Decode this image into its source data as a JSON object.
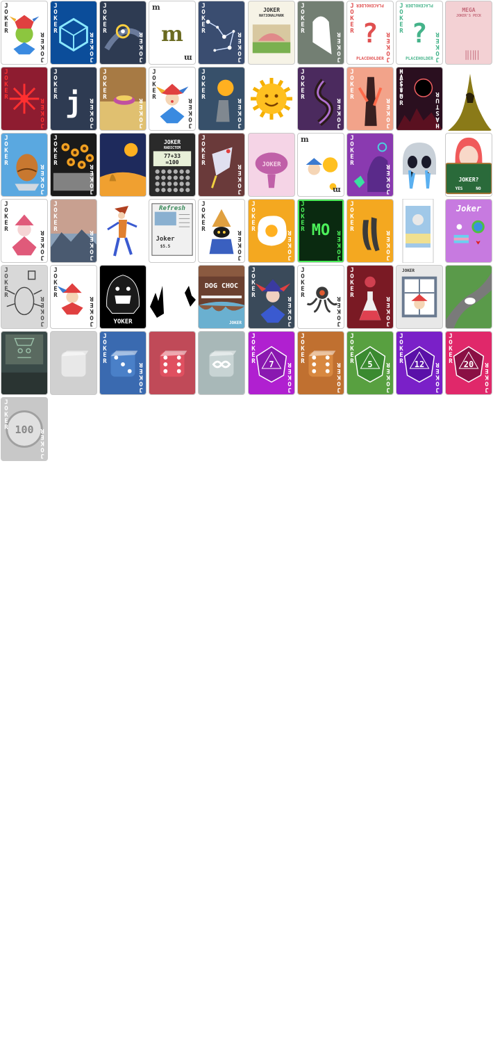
{
  "sheet": {
    "cards": [
      {
        "art": "jester-ball",
        "label": "JOKER",
        "bg": "#ffffff",
        "ink": "#333333"
      },
      {
        "art": "cube",
        "label": "JOKER",
        "bg": "#0b4d9a",
        "ink": "#ffffff"
      },
      {
        "art": "space-star",
        "label": "JOKER",
        "bg": "#2e3b52",
        "ink": "#ffffff"
      },
      {
        "art": "m-letter",
        "corner": "m",
        "bg": "#ffffff",
        "ink": "#333333"
      },
      {
        "art": "constellation",
        "label": "JOKER",
        "bg": "#3a4d70",
        "ink": "#ffffff"
      },
      {
        "art": "national-park",
        "title": "JOKER",
        "subtitle": "NATIONALPARK",
        "bg": "#f6f3e6",
        "ink": "#333333"
      },
      {
        "art": "ghost-glitch",
        "label": "JOKER",
        "bg": "#6c3e9c",
        "ink": "#ffffff"
      },
      {
        "art": "placeholder",
        "label": "JOKER",
        "caption": "PLACEHOLDER",
        "glyph": "?",
        "bg": "#ffffff",
        "ink": "#e05050"
      },
      {
        "art": "placeholder",
        "label": "JOKER",
        "caption": "PLACEHOLDER",
        "glyph": "?",
        "bg": "#ffffff",
        "ink": "#45b38a"
      },
      {
        "art": "receipt",
        "title": "MEGA",
        "subtitle": "JOKER'S PECK",
        "bg": "#f3d1d4",
        "ink": "#c46a7a"
      },
      {
        "art": "red-star",
        "label": "JOKER",
        "bg": "#8e1c30",
        "ink": "#ff3030"
      },
      {
        "art": "j-letter",
        "label": "JOKER",
        "bg": "#2e3b52",
        "ink": "#ffffff"
      },
      {
        "art": "pie-table",
        "label": "JOKER",
        "bg": "#a77a44",
        "ink": "#ffffff"
      },
      {
        "art": "jester",
        "label": "JOKER",
        "bg": "#ffffff",
        "ink": "#333333"
      },
      {
        "art": "sun-hand",
        "label": "JOKER",
        "bg": "#37506a",
        "ink": "#ffffff"
      },
      {
        "art": "sun",
        "bg": "transparent"
      },
      {
        "art": "worm",
        "label": "JOKER",
        "bg": "#4b2a5e",
        "ink": "#ffffff"
      },
      {
        "art": "flame-figure",
        "label": "JOKER",
        "bg": "#f2a38a",
        "ink": "#ffffff"
      },
      {
        "art": "hastur",
        "label": "HASTUR",
        "bg": "#2a0f1f",
        "ink": "#ffffff"
      },
      {
        "art": "robe",
        "bg": "transparent"
      },
      {
        "art": "egg",
        "label": "JOKER",
        "bg": "#5aa8e0",
        "ink": "#ffffff"
      },
      {
        "art": "sunflowers",
        "label": "JOKER",
        "bg": "#1a1a1a",
        "ink": "#ffffff"
      },
      {
        "art": "sun-landscape",
        "bg": "#1e2a5c",
        "ink": "#ffffff"
      },
      {
        "art": "calculator",
        "title": "JOKER",
        "subtitle": "RADICTEM",
        "display_top": "77+33",
        "display_bot": "=100",
        "bg": "#2a2a2a",
        "ink": "#ffffff"
      },
      {
        "art": "bird",
        "label": "JOKER",
        "bg": "#6a3a3a",
        "ink": "#ffffff"
      },
      {
        "art": "pink-brain",
        "title": "JOKER",
        "bg": "#f5d4e6",
        "ink": "#8a3a6a"
      },
      {
        "art": "jester-sun",
        "corner": "m",
        "bg": "#ffffff",
        "ink": "#333333"
      },
      {
        "art": "purple-monster",
        "label": "JOKER",
        "bg": "#8a3ab0",
        "ink": "#ffffff"
      },
      {
        "art": "skull",
        "bg": "transparent"
      },
      {
        "art": "anime-girl",
        "caption": "JOKER?",
        "yes": "YES",
        "no": "NO",
        "bg": "#ffffff",
        "ink": "#ffffff"
      },
      {
        "art": "pink-jester",
        "label": "JOKER",
        "bg": "#ffffff",
        "ink": "#333333"
      },
      {
        "art": "mountains",
        "label": "JOKER",
        "bg": "#8aa0b8",
        "ink": "#ffffff"
      },
      {
        "art": "joker-figure",
        "bg": "transparent"
      },
      {
        "art": "newspaper",
        "title": "Refresh",
        "sub": "Joker",
        "price": "$5.5",
        "bg": "#ffffff",
        "ink": "#333333"
      },
      {
        "art": "black-mage",
        "label": "JOKER",
        "bg": "#ffffff",
        "ink": "#333333"
      },
      {
        "art": "fried-egg",
        "label": "JOKER",
        "bg": "#f4a820",
        "ink": "#ffffff"
      },
      {
        "art": "mo-terminal",
        "label": "JOKER",
        "glyph": "MO",
        "bg": "#0a2a10",
        "ink": "#4cf05a"
      },
      {
        "art": "claws",
        "label": "JOKER",
        "bg": "#f4a820",
        "ink": "#ffffff"
      },
      {
        "art": "tarot-strip",
        "bg": "transparent"
      },
      {
        "art": "stickers",
        "title": "Joker",
        "bg": "#c77ae0",
        "ink": "#ffffff"
      },
      {
        "art": "bug-sketch",
        "label": "JOKER",
        "bg": "#d8d8d8",
        "ink": "#555555"
      },
      {
        "art": "mini-jester",
        "label": "JOKER",
        "bg": "#ffffff",
        "ink": "#333333"
      },
      {
        "art": "shadow-creature",
        "caption": "YOKER",
        "bg": "#000000",
        "ink": "#ffffff"
      },
      {
        "art": "splatter",
        "bg": "transparent"
      },
      {
        "art": "dog-choc",
        "title": "DOG CHOC",
        "sub": "JOKER",
        "bg": "#6a4030",
        "ink": "#ffffff"
      },
      {
        "art": "dark-jester",
        "label": "JOKER",
        "bg": "#3a4a5a",
        "ink": "#ffffff"
      },
      {
        "art": "octopus",
        "label": "JOKER",
        "bg": "#ffffff",
        "ink": "#333333"
      },
      {
        "art": "flask",
        "label": "JOKER",
        "bg": "#7a1a24",
        "ink": "#ffffff"
      },
      {
        "art": "window-jester",
        "title": "JOKER",
        "bg": "#e8e8e8",
        "ink": "#333333"
      },
      {
        "art": "road-car",
        "bg": "#5a9a4a"
      },
      {
        "art": "monitor",
        "bg": "#3a4a48",
        "ink": "#9ac0a8"
      },
      {
        "art": "die",
        "label": "",
        "face": "",
        "bg": "#d0d0d0",
        "ink": "#ffffff",
        "diefill": "#e8e8e8"
      },
      {
        "art": "die",
        "label": "JOKER",
        "face": "3",
        "bg": "#3a6ab0",
        "ink": "#ffffff",
        "diefill": "#4a80c8"
      },
      {
        "art": "die",
        "label": "",
        "face": "6",
        "bg": "#c04a58",
        "ink": "#ffffff",
        "diefill": "#e05060"
      },
      {
        "art": "die",
        "label": "",
        "face": "inf",
        "bg": "#a8b8b8",
        "ink": "#ffffff",
        "diefill": "#c8d4d4"
      },
      {
        "art": "poly",
        "label": "JOKER",
        "face": "7",
        "bg": "#b020d0",
        "ink": "#ffffff",
        "diefill": "#8a18b0"
      },
      {
        "art": "die",
        "label": "JOKER",
        "face": "6",
        "bg": "#c07030",
        "ink": "#ffffff",
        "diefill": "#d88840"
      },
      {
        "art": "poly",
        "label": "JOKER",
        "face": "5",
        "bg": "#58a040",
        "ink": "#ffffff",
        "diefill": "#3a8a30"
      },
      {
        "art": "poly",
        "label": "JOKER",
        "face": "12",
        "bg": "#7a20c8",
        "ink": "#ffffff",
        "diefill": "#5a10a8"
      },
      {
        "art": "poly",
        "label": "JOKER",
        "face": "20",
        "bg": "#e0286a",
        "ink": "#ffffff",
        "diefill": "#8a1044"
      },
      {
        "art": "coin",
        "label": "JOKER",
        "face": "100",
        "bg": "#c8c8c8",
        "ink": "#ffffff",
        "diefill": "#e0e0e0"
      }
    ]
  }
}
